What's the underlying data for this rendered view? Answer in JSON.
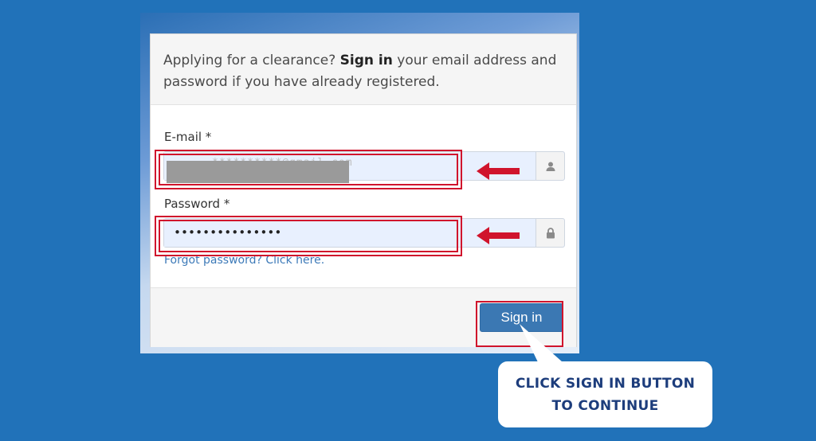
{
  "form": {
    "intro_prefix": "Applying for a clearance? ",
    "intro_bold": "Sign in",
    "intro_suffix": " your email address and password if you have already registered.",
    "email_label": "E-mail *",
    "email_value": "**********@gmail.com",
    "password_label": "Password *",
    "password_value": "•••••••••••••••",
    "forgot_link": "Forgot password? Click here.",
    "signin_label": "Sign in"
  },
  "icons": {
    "email_addon": "user-icon",
    "password_addon": "lock-icon"
  },
  "annotation": {
    "callout_line1": "CLICK SIGN IN BUTTON",
    "callout_line2": "TO CONTINUE",
    "highlight_color": "#d0142c",
    "callout_text_color": "#1d3d7c"
  },
  "colors": {
    "background": "#2172b9",
    "button": "#3b78b3",
    "autofill": "#e8f0fe"
  }
}
